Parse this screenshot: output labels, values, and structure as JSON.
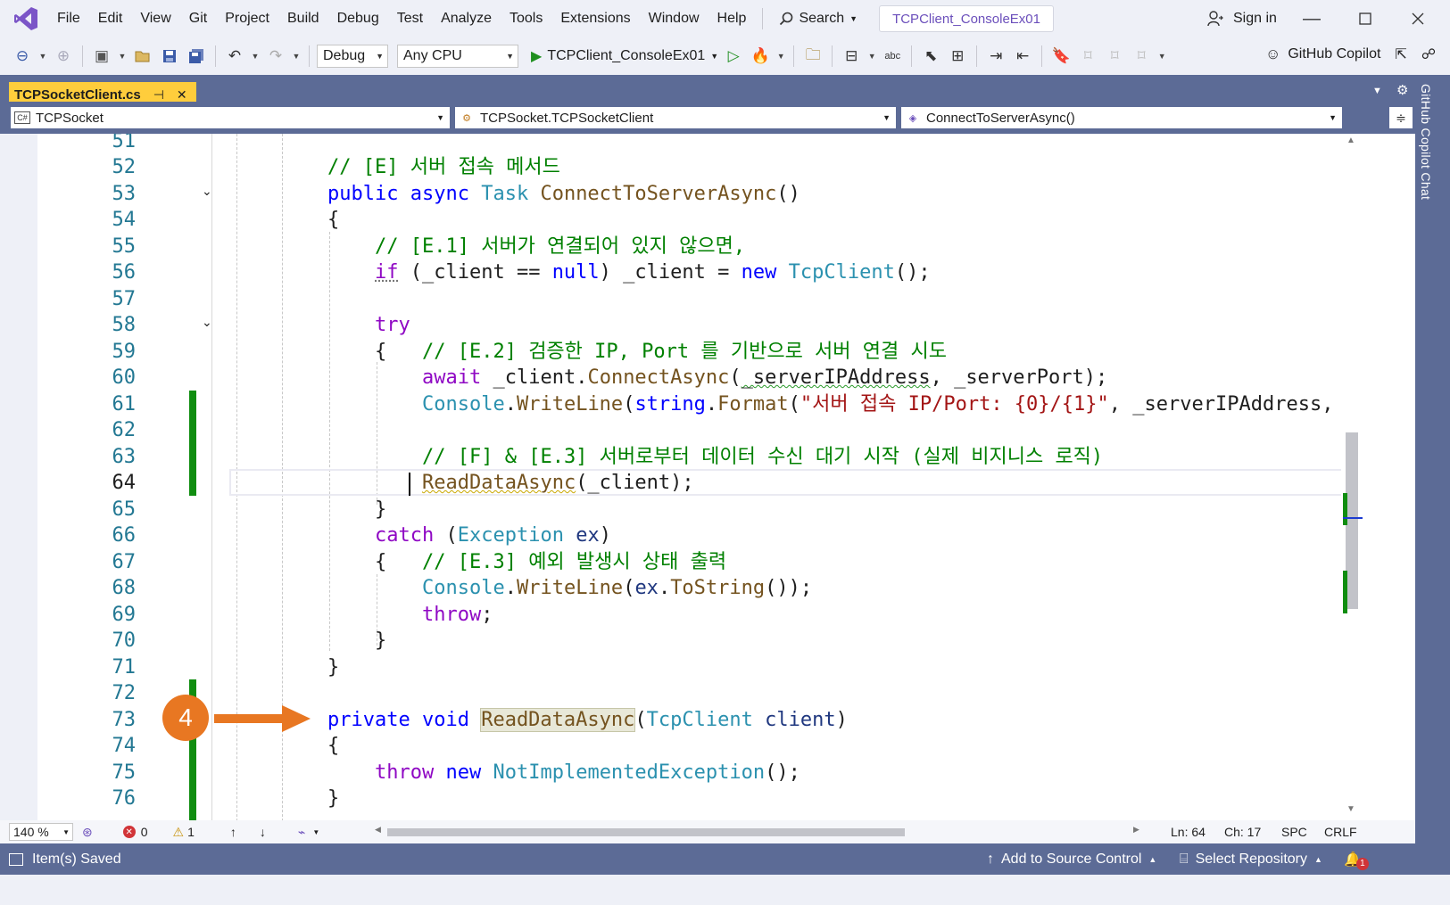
{
  "menu": {
    "items": [
      "File",
      "Edit",
      "View",
      "Git",
      "Project",
      "Build",
      "Debug",
      "Test",
      "Analyze",
      "Tools",
      "Extensions",
      "Window",
      "Help"
    ],
    "search_label": "Search",
    "solution_name": "TCPClient_ConsoleEx01",
    "sign_in": "Sign in"
  },
  "toolbar": {
    "configuration": "Debug",
    "platform": "Any CPU",
    "startup_project": "TCPClient_ConsoleEx01",
    "copilot_label": "GitHub Copilot"
  },
  "document": {
    "tab_title": "TCPSocketClient.cs",
    "nav_project": "TCPSocket",
    "nav_type": "TCPSocket.TCPSocketClient",
    "nav_member": "ConnectToServerAsync()"
  },
  "side_panel": {
    "label": "GitHub Copilot Chat"
  },
  "editor": {
    "current_line_number": "64",
    "lines": [
      {
        "n": "51"
      },
      {
        "n": "52"
      },
      {
        "n": "53"
      },
      {
        "n": "54"
      },
      {
        "n": "55"
      },
      {
        "n": "56"
      },
      {
        "n": "57"
      },
      {
        "n": "58"
      },
      {
        "n": "59"
      },
      {
        "n": "60"
      },
      {
        "n": "61"
      },
      {
        "n": "62"
      },
      {
        "n": "63"
      },
      {
        "n": "64"
      },
      {
        "n": "65"
      },
      {
        "n": "66"
      },
      {
        "n": "67"
      },
      {
        "n": "68"
      },
      {
        "n": "69"
      },
      {
        "n": "70"
      },
      {
        "n": "71"
      },
      {
        "n": "72"
      },
      {
        "n": "73"
      },
      {
        "n": "74"
      },
      {
        "n": "75"
      },
      {
        "n": "76"
      }
    ],
    "code": {
      "l52": "// [E] 서버 접속 메서드",
      "l53_kw1": "public",
      "l53_kw2": "async",
      "l53_ty": "Task",
      "l53_fn": "ConnectToServerAsync",
      "l53_rest": "()",
      "l54": "{",
      "l55": "// [E.1] 서버가 연결되어 있지 않으면,",
      "l56_if": "if",
      "l56_a": " (_client == ",
      "l56_null": "null",
      "l56_b": ") _client = ",
      "l56_new": "new",
      "l56_ty": "TcpClient",
      "l56_c": "();",
      "l58": "try",
      "l59_brace": "{   ",
      "l59_cm": "// [E.2] 검증한 IP, Port 를 기반으로 서버 연결 시도",
      "l60_await": "await",
      "l60_a": " _client.",
      "l60_fn": "ConnectAsync",
      "l60_b": "(",
      "l60_var": "_serverIPAddress",
      "l60_c": ", _serverPort);",
      "l61_ty": "Console",
      "l61_fn": "WriteLine",
      "l61_kw": "string",
      "l61_fn2": "Format",
      "l61_str": "\"서버 접속 IP/Port: {0}/{1}\"",
      "l61_rest": ", _serverIPAddress, _",
      "l63": "// [F] & [E.3] 서버로부터 데이터 수신 대기 시작 (실제 비지니스 로직)",
      "l64_fn": "ReadDataAsync",
      "l64_rest": "(_client);",
      "l65": "}",
      "l66_kw": "catch",
      "l66_ty": "Exception",
      "l66_var": "ex",
      "l67_brace": "{   ",
      "l67_cm": "// [E.3] 예외 발생시 상태 출력",
      "l68_ty": "Console",
      "l68_fn": "WriteLine",
      "l68_var": "ex",
      "l68_fn2": "ToString",
      "l68_rest": "());",
      "l69": "throw",
      "l70": "}",
      "l71": "}",
      "l73_kw1": "private",
      "l73_kw2": "void",
      "l73_fn": "ReadDataAsync",
      "l73_ty": "TcpClient",
      "l73_var": "client",
      "l74": "{",
      "l75_throw": "throw",
      "l75_new": "new",
      "l75_ty": "NotImplementedException",
      "l75_rest": "();",
      "l76": "}"
    }
  },
  "callout": {
    "number": "4",
    "color": "#e87722"
  },
  "editor_status": {
    "zoom": "140 %",
    "errors": "0",
    "warnings": "1",
    "line": "Ln: 64",
    "column": "Ch: 17",
    "whitespace": "SPC",
    "line_ending": "CRLF"
  },
  "statusbar": {
    "message": "Item(s) Saved",
    "source_control": "Add to Source Control",
    "repository": "Select Repository",
    "notification_count": "1"
  },
  "colors": {
    "accent": "#5c6b96",
    "tab_active": "#ffcd3c",
    "change_bar": "#108d10",
    "callout": "#e87722"
  }
}
